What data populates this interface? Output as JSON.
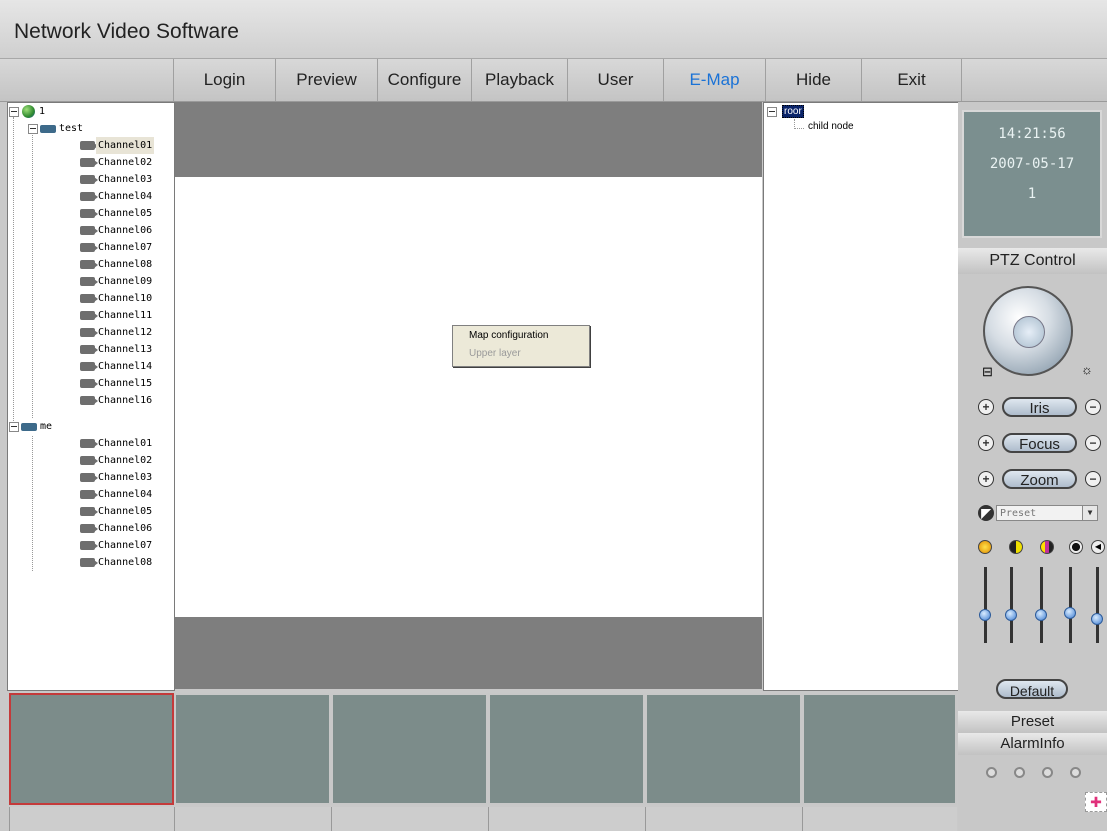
{
  "app": {
    "title": "Network Video Software"
  },
  "menu": [
    {
      "label": "Login",
      "active": false
    },
    {
      "label": "Preview",
      "active": false
    },
    {
      "label": "Configure",
      "active": false
    },
    {
      "label": "Playback",
      "active": false
    },
    {
      "label": "User",
      "active": false
    },
    {
      "label": "E-Map",
      "active": true
    },
    {
      "label": "Hide",
      "active": false
    },
    {
      "label": "Exit",
      "active": false
    }
  ],
  "device_tree": {
    "root": "1",
    "devices": [
      {
        "name": "test",
        "channels": [
          "Channel01",
          "Channel02",
          "Channel03",
          "Channel04",
          "Channel05",
          "Channel06",
          "Channel07",
          "Channel08",
          "Channel09",
          "Channel10",
          "Channel11",
          "Channel12",
          "Channel13",
          "Channel14",
          "Channel15",
          "Channel16"
        ]
      },
      {
        "name": "me",
        "channels": [
          "Channel01",
          "Channel02",
          "Channel03",
          "Channel04",
          "Channel05",
          "Channel06",
          "Channel07",
          "Channel08"
        ]
      }
    ]
  },
  "context_menu": {
    "items": [
      "Map configuration",
      "Upper layer"
    ]
  },
  "map_tree": {
    "root": "roor",
    "child": "child node"
  },
  "clock": {
    "time": "14:21:56",
    "date": "2007-05-17",
    "index": "1"
  },
  "ptz": {
    "header": "PTZ Control",
    "iris": "Iris",
    "focus": "Focus",
    "zoom": "Zoom",
    "preset_placeholder": "Preset",
    "default": "Default"
  },
  "sections": {
    "preset": "Preset",
    "alarminfo": "AlarmInfo"
  },
  "colors": {
    "active_menu": "#1a72d6",
    "selected_cell": "#c43a3a"
  }
}
